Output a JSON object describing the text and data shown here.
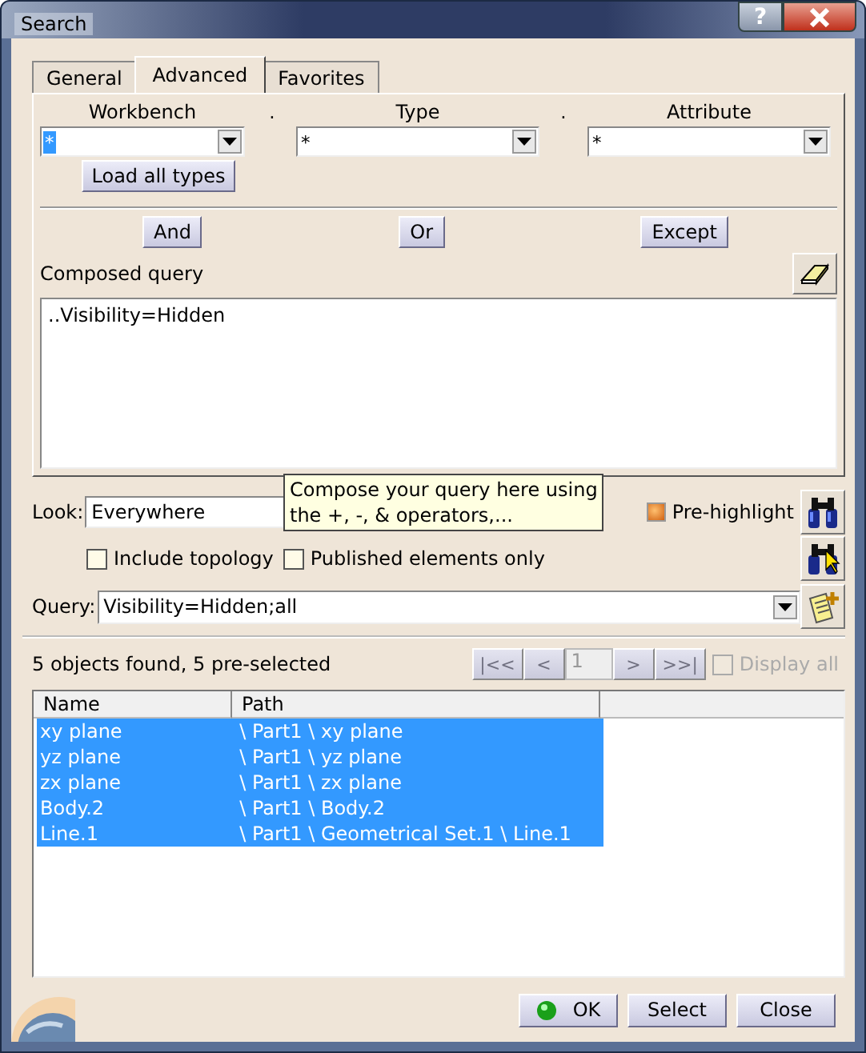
{
  "window": {
    "title": "Search",
    "help_button": "?"
  },
  "tabs": [
    {
      "label": "General",
      "selected": false
    },
    {
      "label": "Advanced",
      "selected": true
    },
    {
      "label": "Favorites",
      "selected": false
    }
  ],
  "criteria": [
    {
      "label": "Workbench",
      "value": "*",
      "highlighted": true
    },
    {
      "label": "Type",
      "value": "*",
      "highlighted": false
    },
    {
      "label": "Attribute",
      "value": "*",
      "highlighted": false
    }
  ],
  "separators": [
    ".",
    "."
  ],
  "load_button": "Load all types",
  "operators": [
    "And",
    "Or",
    "Except"
  ],
  "composed_query": {
    "label": "Composed query",
    "value": "..Visibility=Hidden"
  },
  "tooltip": [
    "Compose your query here using",
    "the +, -, & operators,..."
  ],
  "look": {
    "label": "Look:",
    "value": "Everywhere"
  },
  "pre_highlight": {
    "label": "Pre-highlight",
    "on": true
  },
  "options": [
    {
      "label": "Include topology",
      "checked": false
    },
    {
      "label": "Published elements only",
      "checked": false
    }
  ],
  "query": {
    "label": "Query:",
    "value": "Visibility=Hidden;all"
  },
  "status": "5 objects found, 5 pre-selected",
  "pager": {
    "buttons": [
      "|<<",
      "<",
      ">",
      ">>|"
    ],
    "page": "1",
    "disabled": true
  },
  "display_all": {
    "label": "Display all",
    "checked": false,
    "disabled": true
  },
  "table": {
    "columns": [
      "Name",
      "Path"
    ],
    "rows": [
      {
        "cells": [
          "xy plane",
          "\\ Part1 \\ xy plane"
        ],
        "selected": true
      },
      {
        "cells": [
          "yz plane",
          "\\ Part1 \\ yz plane"
        ],
        "selected": true
      },
      {
        "cells": [
          "zx plane",
          "\\ Part1 \\ zx plane"
        ],
        "selected": true
      },
      {
        "cells": [
          "Body.2",
          "\\ Part1 \\ Body.2"
        ],
        "selected": true
      },
      {
        "cells": [
          "Line.1",
          "\\ Part1 \\ Geometrical Set.1 \\ Line.1"
        ],
        "selected": true
      }
    ]
  },
  "buttons": [
    {
      "label": "OK",
      "kind": "ok"
    },
    {
      "label": "Select",
      "kind": "plain"
    },
    {
      "label": "Close",
      "kind": "plain"
    }
  ]
}
